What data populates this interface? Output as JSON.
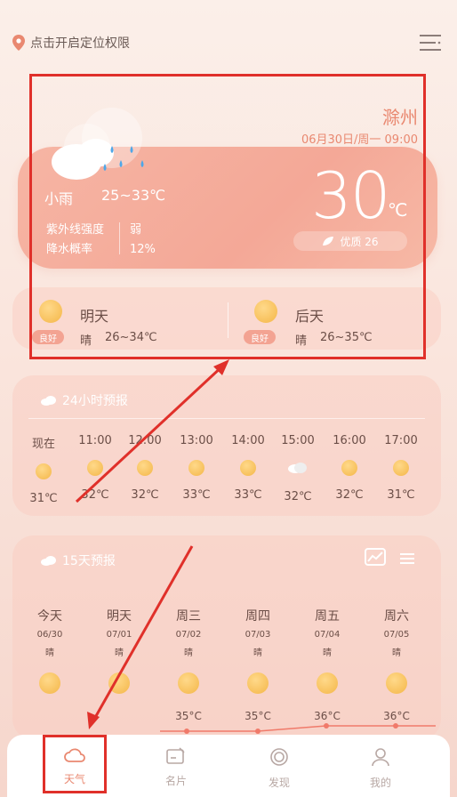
{
  "header": {
    "location_prompt": "点击开启定位权限",
    "pin_icon": "location-pin-icon",
    "menu_icon": "menu-icon"
  },
  "current": {
    "city": "滁州",
    "date": "06月30日/周一 09:00",
    "condition": "小雨",
    "range": "25~33℃",
    "temp": "30",
    "unit": "℃",
    "uv_label": "紫外线强度",
    "uv_value": "弱",
    "rain_label": "降水概率",
    "rain_value": "12%",
    "aqi": "优质 26"
  },
  "next_days": [
    {
      "label": "明天",
      "badge": "良好",
      "condition": "晴",
      "range": "26~34℃"
    },
    {
      "label": "后天",
      "badge": "良好",
      "condition": "晴",
      "range": "26~35℃"
    }
  ],
  "hourly": {
    "title": "24小时预报",
    "items": [
      {
        "time": "现在",
        "temp": "31℃",
        "icon": "sun-icon"
      },
      {
        "time": "11:00",
        "temp": "32℃",
        "icon": "sun-icon"
      },
      {
        "time": "12:00",
        "temp": "32℃",
        "icon": "sun-icon"
      },
      {
        "time": "13:00",
        "temp": "33℃",
        "icon": "sun-icon"
      },
      {
        "time": "14:00",
        "temp": "33℃",
        "icon": "sun-icon"
      },
      {
        "time": "15:00",
        "temp": "32℃",
        "icon": "cloud-sun-icon"
      },
      {
        "time": "16:00",
        "temp": "32℃",
        "icon": "sun-icon"
      },
      {
        "time": "17:00",
        "temp": "31℃",
        "icon": "sun-icon"
      }
    ]
  },
  "daily": {
    "title": "15天预报",
    "items": [
      {
        "day": "今天",
        "date": "06/30",
        "cond": "晴",
        "high": ""
      },
      {
        "day": "明天",
        "date": "07/01",
        "cond": "晴",
        "high": ""
      },
      {
        "day": "周三",
        "date": "07/02",
        "cond": "晴",
        "high": "35°C"
      },
      {
        "day": "周四",
        "date": "07/03",
        "cond": "晴",
        "high": "35°C"
      },
      {
        "day": "周五",
        "date": "07/04",
        "cond": "晴",
        "high": "36°C"
      },
      {
        "day": "周六",
        "date": "07/05",
        "cond": "晴",
        "high": "36°C"
      }
    ]
  },
  "nav": [
    {
      "label": "天气",
      "icon": "cloud-icon"
    },
    {
      "label": "名片",
      "icon": "card-icon"
    },
    {
      "label": "发现",
      "icon": "discover-icon"
    },
    {
      "label": "我的",
      "icon": "user-icon"
    }
  ],
  "colors": {
    "accent": "#e98870",
    "highlight": "#e0302a"
  }
}
